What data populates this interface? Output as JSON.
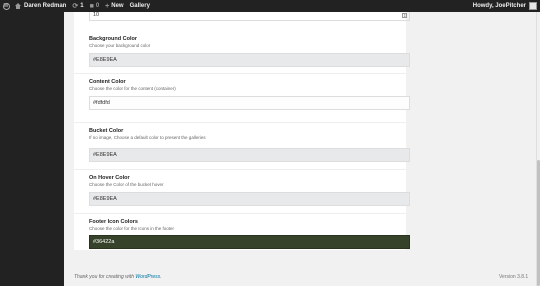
{
  "admin_bar": {
    "wp_logo": "W",
    "site_name": "Daren Redman",
    "updates_count": "1",
    "comments_count": "0",
    "new_label": "New",
    "gallery_label": "Gallery",
    "howdy": "Howdy, JoePitcher"
  },
  "top_field": {
    "value": "10"
  },
  "fields": [
    {
      "title": "Background Color",
      "desc": "Choose your background color",
      "value": "#E8E9EA",
      "swatch": "#E8E9EA"
    },
    {
      "title": "Content Color",
      "desc": "Choose the color for the content (container)",
      "value": "#fdfdfd",
      "swatch": "#fdfdfd"
    },
    {
      "title": "Bucket Color",
      "desc": "If no image, Choose a default color to present the galleries",
      "value": "#E8E9EA",
      "swatch": "#E8E9EA"
    },
    {
      "title": "On Hover Color",
      "desc": "Choose the Color of the bucket hover",
      "value": "#E8E9EA",
      "swatch": "#E8E9EA"
    },
    {
      "title": "Footer Icon Colors",
      "desc": "Choose the color for the Icons in the footer",
      "value": "#36422a",
      "swatch": "#36422a"
    }
  ],
  "footer": {
    "thanks_prefix": "Thank you for creating with ",
    "wordpress_link": "WordPress",
    "thanks_suffix": ".",
    "version": "Version 3.8.1"
  },
  "colors": {
    "admin_bar_bg": "#222222",
    "page_bg": "#f1f1f1",
    "link": "#0074a2"
  }
}
